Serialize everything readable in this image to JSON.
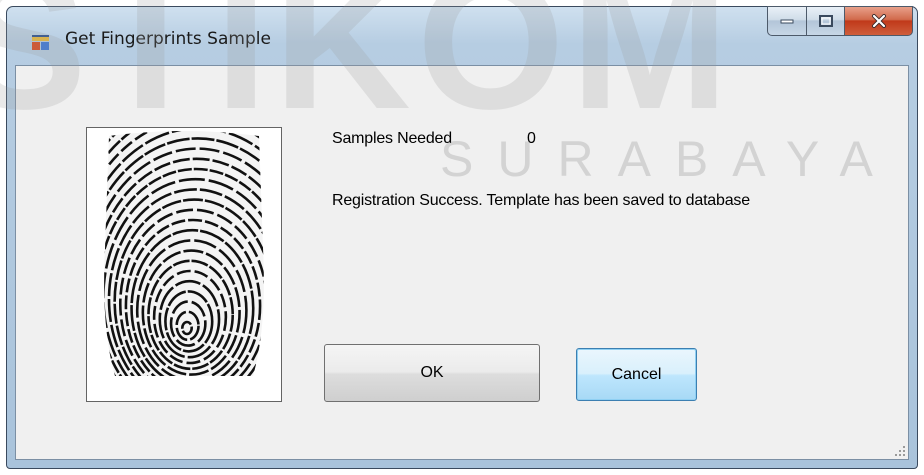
{
  "window": {
    "title": "Get Fingerprints Sample",
    "app_icon": "app-window-icon",
    "controls": {
      "minimize": "minimize-icon",
      "maximize": "maximize-icon",
      "close": "close-icon"
    }
  },
  "watermark": {
    "text": "STIKOM",
    "subtext": "SURABAYA"
  },
  "main": {
    "fingerprint_image": "fingerprint-image",
    "samples_label": "Samples Needed",
    "samples_value": "0",
    "status_message": "Registration Success. Template has been saved to database"
  },
  "buttons": {
    "ok_label": "OK",
    "cancel_label": "Cancel"
  }
}
